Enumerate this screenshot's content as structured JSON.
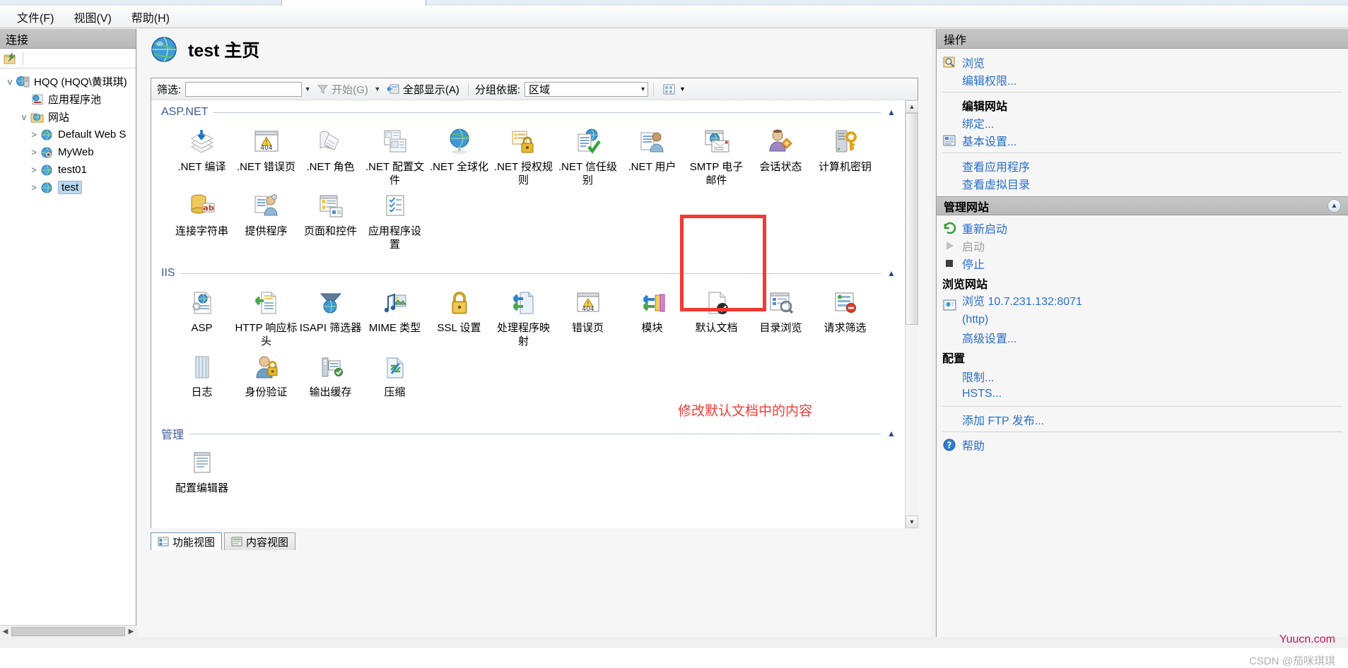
{
  "window": {
    "menu": [
      {
        "label": "文件(F)",
        "name": "menu-file"
      },
      {
        "label": "视图(V)",
        "name": "menu-view"
      },
      {
        "label": "帮助(H)",
        "name": "menu-help"
      }
    ]
  },
  "connections": {
    "header": "连接",
    "tree": [
      {
        "label": "HQQ (HQQ\\黄琪琪)",
        "level": 1,
        "expander": "v",
        "icon": "server-icon",
        "selected": false
      },
      {
        "label": "应用程序池",
        "level": 2,
        "expander": "",
        "icon": "app-pool-icon",
        "selected": false
      },
      {
        "label": "网站",
        "level": 2,
        "expander": "v",
        "icon": "sites-folder-icon",
        "selected": false
      },
      {
        "label": "Default Web S",
        "level": 3,
        "expander": ">",
        "icon": "website-icon",
        "selected": false
      },
      {
        "label": "MyWeb",
        "level": 3,
        "expander": ">",
        "icon": "website-stopped-icon",
        "selected": false
      },
      {
        "label": "test01",
        "level": 3,
        "expander": ">",
        "icon": "website-icon",
        "selected": false
      },
      {
        "label": "test",
        "level": 3,
        "expander": ">",
        "icon": "website-icon",
        "selected": true
      }
    ]
  },
  "page": {
    "title": "test 主页"
  },
  "toolbar": {
    "filter_label": "筛选:",
    "filter_value": "",
    "filter_placeholder": "",
    "start_label": "开始(G)",
    "show_all_label": "全部显示(A)",
    "group_by_label": "分组依据:",
    "group_by_value": "区域"
  },
  "sections": [
    {
      "title": "ASP.NET",
      "name": "section-aspnet",
      "items": [
        {
          "label": ".NET 编译",
          "icon": "net-compilation-icon"
        },
        {
          "label": ".NET 错误页",
          "icon": "net-error-pages-icon"
        },
        {
          "label": ".NET 角色",
          "icon": "net-roles-icon"
        },
        {
          "label": ".NET 配置文件",
          "icon": "net-profile-icon"
        },
        {
          "label": ".NET 全球化",
          "icon": "net-globalization-icon"
        },
        {
          "label": ".NET 授权规则",
          "icon": "net-authorization-icon"
        },
        {
          "label": ".NET 信任级别",
          "icon": "net-trust-levels-icon"
        },
        {
          "label": ".NET 用户",
          "icon": "net-users-icon"
        },
        {
          "label": "SMTP 电子邮件",
          "icon": "smtp-email-icon"
        },
        {
          "label": "会话状态",
          "icon": "session-state-icon"
        },
        {
          "label": "计算机密钥",
          "icon": "machine-key-icon"
        },
        {
          "label": "连接字符串",
          "icon": "connection-strings-icon"
        },
        {
          "label": "提供程序",
          "icon": "providers-icon"
        },
        {
          "label": "页面和控件",
          "icon": "pages-and-controls-icon"
        },
        {
          "label": "应用程序设置",
          "icon": "application-settings-icon"
        }
      ]
    },
    {
      "title": "IIS",
      "name": "section-iis",
      "items": [
        {
          "label": "ASP",
          "icon": "asp-icon"
        },
        {
          "label": "HTTP 响应标头",
          "icon": "http-response-headers-icon"
        },
        {
          "label": "ISAPI 筛选器",
          "icon": "isapi-filters-icon"
        },
        {
          "label": "MIME 类型",
          "icon": "mime-types-icon"
        },
        {
          "label": "SSL 设置",
          "icon": "ssl-settings-icon"
        },
        {
          "label": "处理程序映射",
          "icon": "handler-mappings-icon"
        },
        {
          "label": "错误页",
          "icon": "error-pages-icon"
        },
        {
          "label": "模块",
          "icon": "modules-icon"
        },
        {
          "label": "默认文档",
          "icon": "default-document-icon",
          "highlighted": true
        },
        {
          "label": "目录浏览",
          "icon": "directory-browsing-icon"
        },
        {
          "label": "请求筛选",
          "icon": "request-filtering-icon"
        },
        {
          "label": "日志",
          "icon": "logging-icon"
        },
        {
          "label": "身份验证",
          "icon": "authentication-icon"
        },
        {
          "label": "输出缓存",
          "icon": "output-caching-icon"
        },
        {
          "label": "压缩",
          "icon": "compression-icon"
        }
      ]
    },
    {
      "title": "管理",
      "name": "section-management",
      "items": [
        {
          "label": "配置编辑器",
          "icon": "configuration-editor-icon"
        }
      ]
    }
  ],
  "annotation": {
    "text": "修改默认文档中的内容"
  },
  "view_tabs": [
    {
      "label": "功能视图",
      "icon": "features-view-icon",
      "active": true
    },
    {
      "label": "内容视图",
      "icon": "content-view-icon",
      "active": false
    }
  ],
  "actions": {
    "header": "操作",
    "groups": [
      {
        "type": "plain",
        "items": [
          {
            "label": "浏览",
            "kind": "link",
            "icon": "browse-icon"
          },
          {
            "label": "编辑权限...",
            "kind": "link",
            "icon": ""
          }
        ]
      },
      {
        "type": "plain",
        "divider": true,
        "items": [
          {
            "label": "编辑网站",
            "kind": "title",
            "icon": ""
          },
          {
            "label": "绑定...",
            "kind": "link",
            "icon": ""
          },
          {
            "label": "基本设置...",
            "kind": "link",
            "icon": "basic-settings-icon"
          }
        ]
      },
      {
        "type": "plain",
        "divider": true,
        "items": [
          {
            "label": "查看应用程序",
            "kind": "link",
            "icon": ""
          },
          {
            "label": "查看虚拟目录",
            "kind": "link",
            "icon": ""
          }
        ]
      },
      {
        "type": "group",
        "header": "管理网站",
        "collapsible": true,
        "items": [
          {
            "label": "重新启动",
            "kind": "link",
            "icon": "restart-icon"
          },
          {
            "label": "启动",
            "kind": "disabled",
            "icon": "start-icon"
          },
          {
            "label": "停止",
            "kind": "link",
            "icon": "stop-icon"
          },
          {
            "label": "浏览网站",
            "kind": "subtitle",
            "icon": ""
          },
          {
            "label": "浏览 10.7.231.132:8071 (http)",
            "kind": "link",
            "icon": "browse-site-icon"
          },
          {
            "label": "高级设置...",
            "kind": "link",
            "icon": ""
          },
          {
            "label": "配置",
            "kind": "subtitle",
            "icon": ""
          },
          {
            "label": "限制...",
            "kind": "link",
            "icon": ""
          },
          {
            "label": "HSTS...",
            "kind": "link",
            "icon": ""
          },
          {
            "label": "添加 FTP 发布...",
            "kind": "link",
            "icon": ""
          },
          {
            "label": "帮助",
            "kind": "link",
            "icon": "help-icon"
          }
        ]
      }
    ]
  },
  "watermarks": {
    "line1": "Yuucn.com",
    "line2": "CSDN @茄咪琪琪"
  },
  "colors": {
    "section_title": "#3a5a96",
    "link": "#2a6fc9",
    "highlight_box": "#f33a34",
    "annotation": "#ef3b36"
  }
}
